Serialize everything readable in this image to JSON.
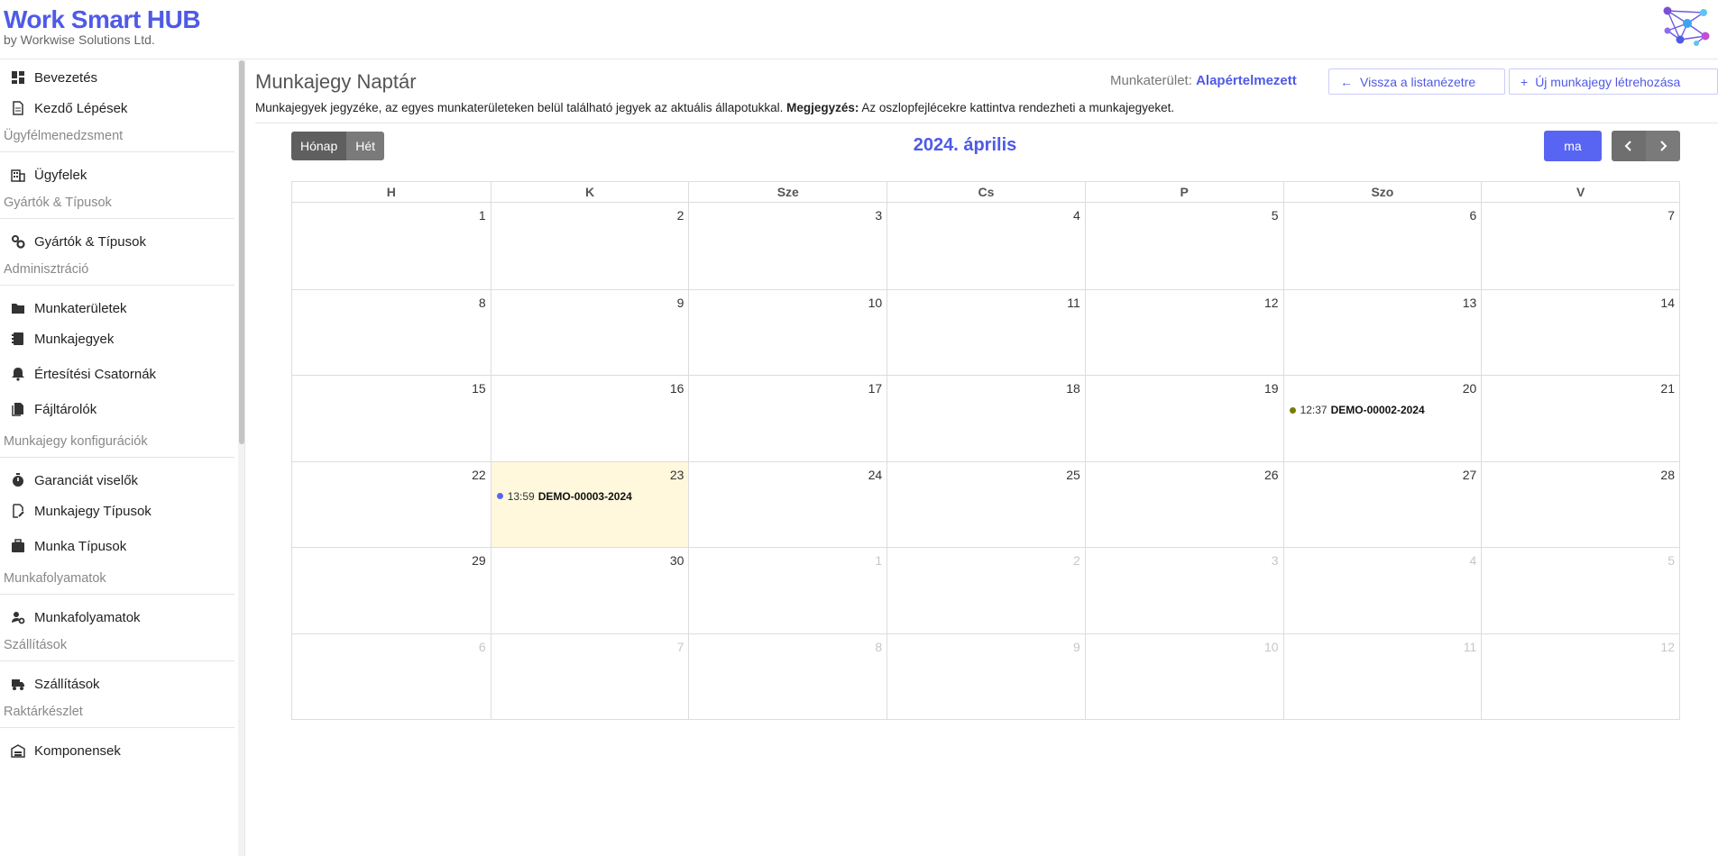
{
  "header": {
    "title": "Work Smart HUB",
    "subtitle": "by Workwise Solutions Ltd."
  },
  "sidebar": {
    "items": [
      {
        "type": "item",
        "label": "Bevezetés",
        "icon": "dashboard-icon"
      },
      {
        "type": "item",
        "label": "Kezdő Lépések",
        "icon": "document-icon"
      },
      {
        "type": "section",
        "label": "Ügyfélmenedzsment"
      },
      {
        "type": "item",
        "label": "Ügyfelek",
        "icon": "building-icon"
      },
      {
        "type": "section",
        "label": "Gyártók & Típusok"
      },
      {
        "type": "item",
        "label": "Gyártók & Típusok",
        "icon": "gears-icon"
      },
      {
        "type": "section",
        "label": "Adminisztráció"
      },
      {
        "type": "item",
        "label": "Munkaterületek",
        "icon": "folder-icon"
      },
      {
        "type": "item",
        "label": "Munkajegyek",
        "icon": "notebook-icon"
      },
      {
        "type": "item",
        "label": "Értesítési Csatornák",
        "icon": "bell-icon"
      },
      {
        "type": "item",
        "label": "Fájltárolók",
        "icon": "files-icon"
      },
      {
        "type": "section",
        "label": "Munkajegy konfigurációk"
      },
      {
        "type": "item",
        "label": "Garanciát viselők",
        "icon": "stopwatch-icon"
      },
      {
        "type": "item",
        "label": "Munkajegy Típusok",
        "icon": "edit-document-icon"
      },
      {
        "type": "item",
        "label": "Munka Típusok",
        "icon": "briefcase-icon"
      },
      {
        "type": "section",
        "label": "Munkafolyamatok"
      },
      {
        "type": "item",
        "label": "Munkafolyamatok",
        "icon": "user-gear-icon"
      },
      {
        "type": "section",
        "label": "Szállítások"
      },
      {
        "type": "item",
        "label": "Szállítások",
        "icon": "truck-icon"
      },
      {
        "type": "section",
        "label": "Raktárkészlet"
      },
      {
        "type": "item",
        "label": "Komponensek",
        "icon": "warehouse-icon"
      }
    ]
  },
  "page": {
    "title": "Munkajegy Naptár",
    "workspace_label": "Munkaterület:",
    "workspace_value": "Alapértelmezett",
    "back_button": "Vissza a listanézetre",
    "new_button": "Új munkajegy létrehozása",
    "description": "Munkajegyek jegyzéke, az egyes munkaterületeken belül található jegyek az aktuális állapotukkal.",
    "note_label": "Megjegyzés:",
    "note_text": "Az oszlopfejlécekre kattintva rendezheti a munkajegyeket."
  },
  "calendar": {
    "view_month": "Hónap",
    "view_week": "Hét",
    "month_title": "2024. április",
    "today_label": "ma",
    "weekdays": [
      "H",
      "K",
      "Sze",
      "Cs",
      "P",
      "Szo",
      "V"
    ],
    "weeks": [
      [
        1,
        2,
        3,
        4,
        5,
        6,
        7
      ],
      [
        8,
        9,
        10,
        11,
        12,
        13,
        14
      ],
      [
        15,
        16,
        17,
        18,
        19,
        20,
        21
      ],
      [
        22,
        23,
        24,
        25,
        26,
        27,
        28
      ],
      [
        29,
        30,
        1,
        2,
        3,
        4,
        5
      ],
      [
        6,
        7,
        8,
        9,
        10,
        11,
        12
      ]
    ],
    "today_cell": [
      3,
      1
    ],
    "other_month_from": [
      4,
      2
    ],
    "events": [
      {
        "week": 2,
        "day": 5,
        "time": "12:37",
        "code": "DEMO-00002-2024",
        "color": "#7a7a00"
      },
      {
        "week": 3,
        "day": 1,
        "time": "13:59",
        "code": "DEMO-00003-2024",
        "color": "#5865f2"
      }
    ]
  },
  "colors": {
    "brand": "#4f5ae6",
    "today_bg": "#fff8dd"
  }
}
